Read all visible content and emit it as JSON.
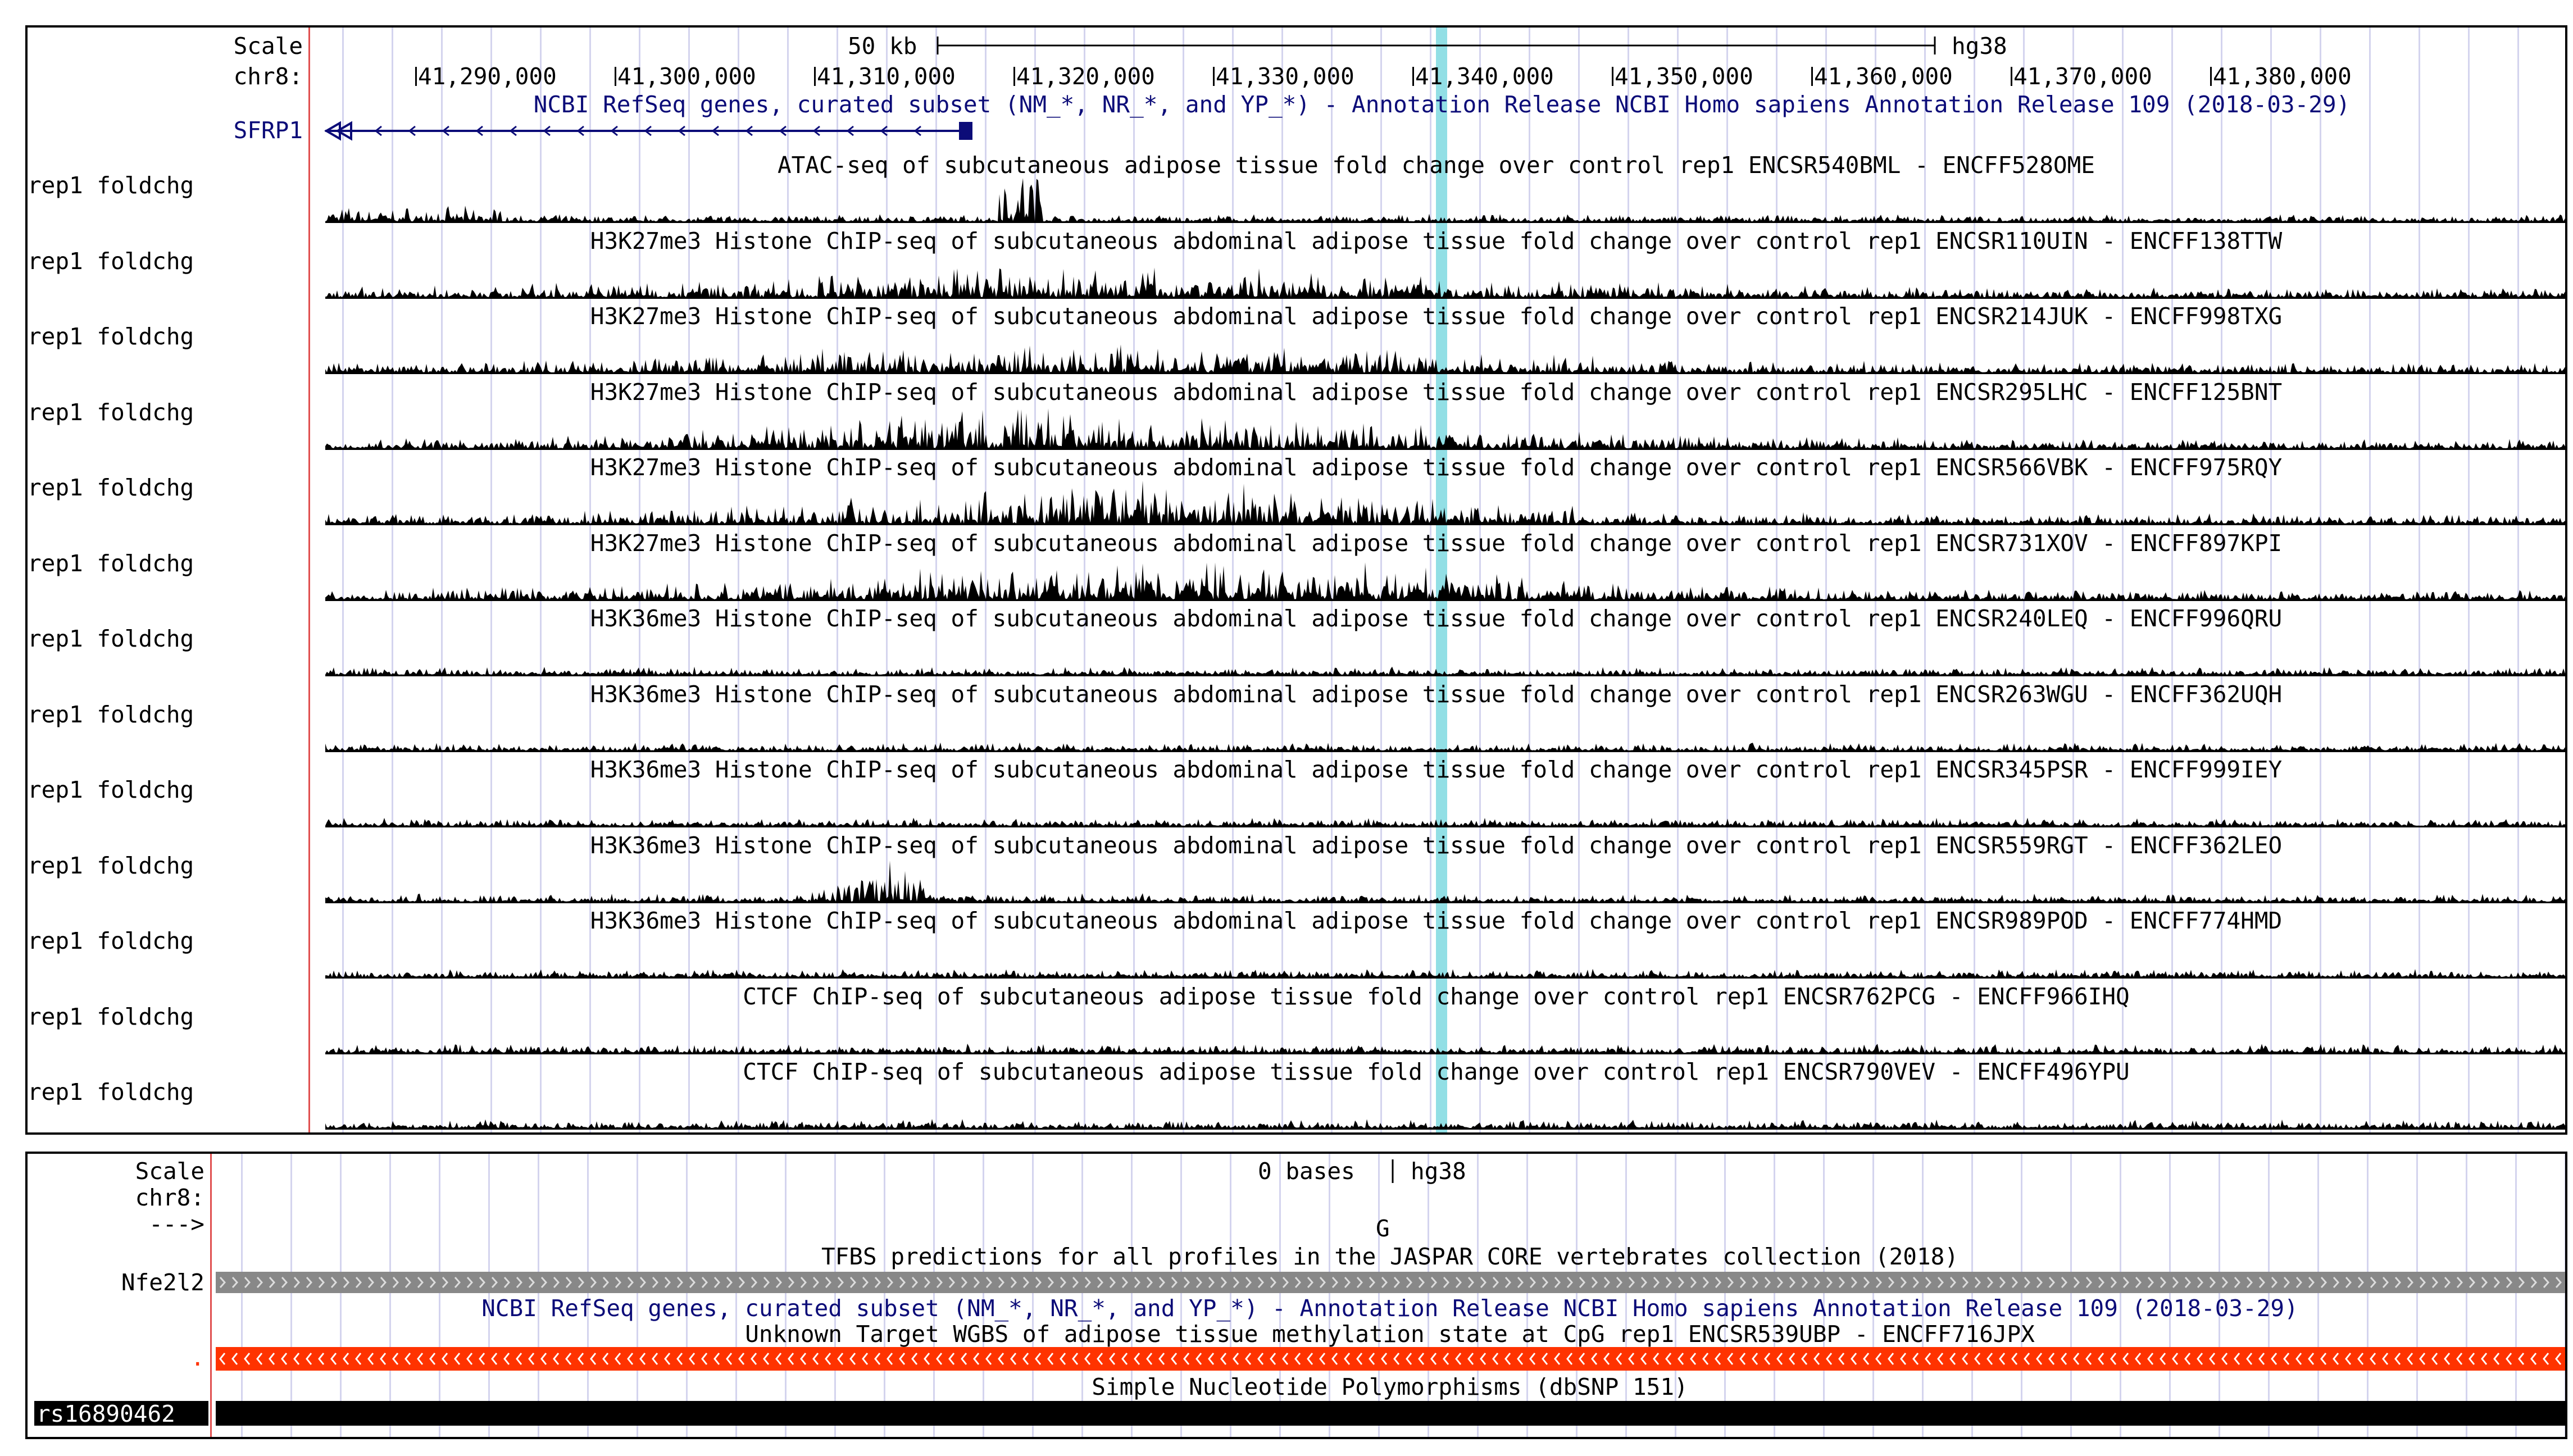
{
  "browser": {
    "colors": {
      "highlight": "#7fd9e0",
      "gene": "#0c0c78",
      "signal": "#000000",
      "tfbs_bar": "#888888",
      "wgbs_bar": "#ff3300",
      "grid": "#d4d4ee"
    },
    "top": {
      "scale_label": "Scale",
      "chrom_label": "chr8:",
      "scalebar_text": "50 kb",
      "assembly": "hg38",
      "positions": [
        "41,290,000",
        "41,300,000",
        "41,310,000",
        "41,320,000",
        "41,330,000",
        "41,340,000",
        "41,350,000",
        "41,360,000",
        "41,370,000",
        "41,380,000"
      ],
      "refseq_title": "NCBI RefSeq genes, curated subset (NM_*, NR_*, and YP_*) - Annotation Release NCBI Homo sapiens Annotation Release 109 (2018-03-29)",
      "gene_name": "SFRP1",
      "tracks": [
        {
          "label": "rep1 foldchg",
          "title": "ATAC-seq of subcutaneous adipose tissue fold change over control rep1 ENCSR540BML - ENCFF528OME"
        },
        {
          "label": "rep1 foldchg",
          "title": "H3K27me3 Histone ChIP-seq of subcutaneous abdominal adipose tissue fold change over control rep1 ENCSR110UIN - ENCFF138TTW"
        },
        {
          "label": "rep1 foldchg",
          "title": "H3K27me3 Histone ChIP-seq of subcutaneous abdominal adipose tissue fold change over control rep1 ENCSR214JUK - ENCFF998TXG"
        },
        {
          "label": "rep1 foldchg",
          "title": "H3K27me3 Histone ChIP-seq of subcutaneous abdominal adipose tissue fold change over control rep1 ENCSR295LHC - ENCFF125BNT"
        },
        {
          "label": "rep1 foldchg",
          "title": "H3K27me3 Histone ChIP-seq of subcutaneous abdominal adipose tissue fold change over control rep1 ENCSR566VBK - ENCFF975RQY"
        },
        {
          "label": "rep1 foldchg",
          "title": "H3K27me3 Histone ChIP-seq of subcutaneous abdominal adipose tissue fold change over control rep1 ENCSR731XOV - ENCFF897KPI"
        },
        {
          "label": "rep1 foldchg",
          "title": "H3K36me3 Histone ChIP-seq of subcutaneous abdominal adipose tissue fold change over control rep1 ENCSR240LEQ - ENCFF996QRU"
        },
        {
          "label": "rep1 foldchg",
          "title": "H3K36me3 Histone ChIP-seq of subcutaneous abdominal adipose tissue fold change over control rep1 ENCSR263WGU - ENCFF362UQH"
        },
        {
          "label": "rep1 foldchg",
          "title": "H3K36me3 Histone ChIP-seq of subcutaneous abdominal adipose tissue fold change over control rep1 ENCSR345PSR - ENCFF999IEY"
        },
        {
          "label": "rep1 foldchg",
          "title": "H3K36me3 Histone ChIP-seq of subcutaneous abdominal adipose tissue fold change over control rep1 ENCSR559RGT - ENCFF362LEO"
        },
        {
          "label": "rep1 foldchg",
          "title": "H3K36me3 Histone ChIP-seq of subcutaneous abdominal adipose tissue fold change over control rep1 ENCSR989POD - ENCFF774HMD"
        },
        {
          "label": "rep1 foldchg",
          "title": "CTCF ChIP-seq of subcutaneous adipose tissue fold change over control rep1 ENCSR762PCG - ENCFF966IHQ"
        },
        {
          "label": "rep1 foldchg",
          "title": "CTCF ChIP-seq of subcutaneous adipose tissue fold change over control rep1 ENCSR790VEV - ENCFF496YPU"
        }
      ]
    },
    "bottom": {
      "scale_label": "Scale",
      "chrom_label": "chr8:",
      "strand_label": "--->",
      "scalebar_text": "0 bases",
      "assembly": "hg38",
      "base": "G",
      "tfbs_title": "TFBS predictions for all profiles in the JASPAR CORE vertebrates collection (2018)",
      "tfbs_label": "Nfe2l2",
      "refseq_title": "NCBI RefSeq genes, curated subset (NM_*, NR_*, and YP_*) - Annotation Release NCBI Homo sapiens Annotation Release 109 (2018-03-29)",
      "wgbs_title": "Unknown Target WGBS of adipose tissue methylation state at CpG rep1 ENCSR539UBP - ENCFF716JPX",
      "wgbs_label": ".",
      "snp_title": "Simple Nucleotide Polymorphisms (dbSNP 151)",
      "snp_label": "rs16890462"
    }
  }
}
